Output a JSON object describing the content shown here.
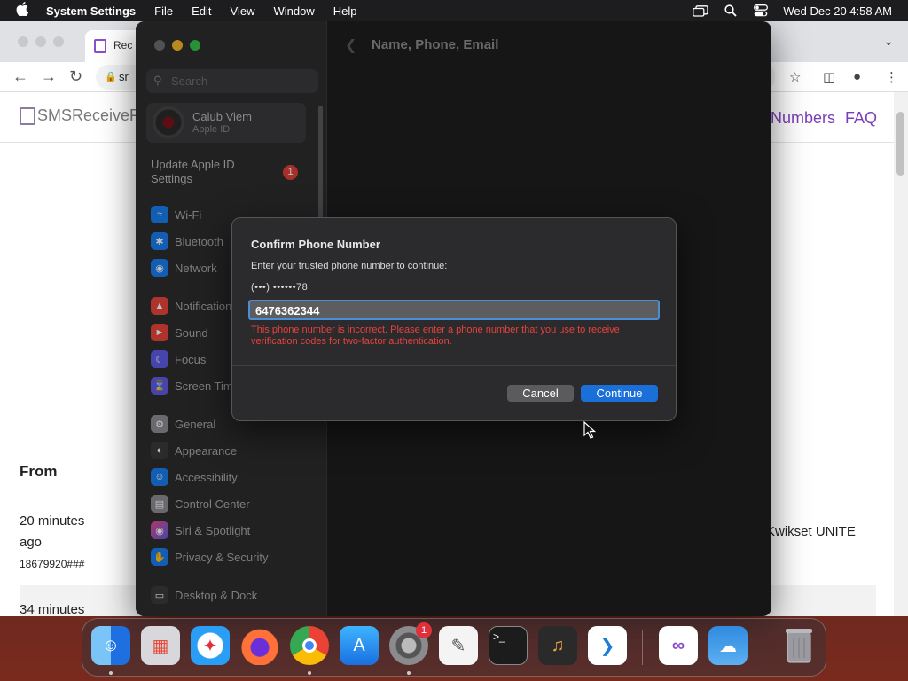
{
  "menubar": {
    "app_name": "System Settings",
    "items": [
      "File",
      "Edit",
      "View",
      "Window",
      "Help"
    ],
    "clock": "Wed Dec 20  4:58 AM"
  },
  "browser": {
    "tab_title": "Rec",
    "url_text": "sr",
    "site_logo": "SMSReceiveFre",
    "nav_numbers": "Numbers",
    "nav_faq": "FAQ",
    "from_heading": "From",
    "time1_line1": "20 minutes",
    "time1_line2": "ago",
    "sender1": "18679920###",
    "message_snippet": "Kwikset UNITE",
    "time2": "34 minutes"
  },
  "settings": {
    "search_placeholder": "Search",
    "account_name": "Calub Viem",
    "account_sub": "Apple ID",
    "update_label": "Update Apple ID Settings",
    "update_badge": "1",
    "content_title": "Name, Phone, Email",
    "sidebar_items": [
      {
        "label": "Wi-Fi",
        "icon": "wifi-icon",
        "color": "#1a7ef2"
      },
      {
        "label": "Bluetooth",
        "icon": "bluetooth-icon",
        "color": "#1a7ef2"
      },
      {
        "label": "Network",
        "icon": "globe-icon",
        "color": "#1a7ef2"
      },
      {
        "label": "Notifications",
        "icon": "bell-icon",
        "color": "#e8443a"
      },
      {
        "label": "Sound",
        "icon": "speaker-icon",
        "color": "#e8443a"
      },
      {
        "label": "Focus",
        "icon": "moon-icon",
        "color": "#5e5ce6"
      },
      {
        "label": "Screen Time",
        "icon": "hourglass-icon",
        "color": "#5e5ce6"
      },
      {
        "label": "General",
        "icon": "gear-icon",
        "color": "#8e8e93"
      },
      {
        "label": "Appearance",
        "icon": "appearance-icon",
        "color": "#3a3a3c"
      },
      {
        "label": "Accessibility",
        "icon": "accessibility-icon",
        "color": "#1a7ef2"
      },
      {
        "label": "Control Center",
        "icon": "control-center-icon",
        "color": "#8e8e93"
      },
      {
        "label": "Siri & Spotlight",
        "icon": "siri-icon",
        "color": "#b04ad8"
      },
      {
        "label": "Privacy & Security",
        "icon": "hand-icon",
        "color": "#1a7ef2"
      },
      {
        "label": "Desktop & Dock",
        "icon": "desktop-icon",
        "color": "#3a3a3c"
      }
    ]
  },
  "dialog": {
    "title": "Confirm Phone Number",
    "prompt": "Enter your trusted phone number to continue:",
    "masked_number": "(•••) ••••••78",
    "input_value": "6476362344",
    "error": "This phone number is incorrect. Please enter a phone number that you use to receive verification codes for two-factor authentication.",
    "cancel_label": "Cancel",
    "continue_label": "Continue"
  },
  "dock": {
    "settings_badge": "1",
    "apps": [
      {
        "name": "Finder",
        "icon": "finder-icon",
        "color": "#1e8cf0"
      },
      {
        "name": "Launchpad",
        "icon": "launchpad-icon",
        "color": "#e6e6e6"
      },
      {
        "name": "Safari",
        "icon": "safari-icon",
        "color": "#2a9df4"
      },
      {
        "name": "Firefox",
        "icon": "firefox-icon",
        "color": "#ff7139"
      },
      {
        "name": "Chrome",
        "icon": "chrome-icon",
        "color": "#ffffff"
      },
      {
        "name": "App Store",
        "icon": "app-store-icon",
        "color": "#1a8cf0"
      },
      {
        "name": "System Settings",
        "icon": "system-settings-icon",
        "color": "#7d7d82"
      },
      {
        "name": "TextEdit",
        "icon": "textedit-icon",
        "color": "#f2f2f2"
      },
      {
        "name": "Terminal",
        "icon": "terminal-icon",
        "color": "#1c1c1c"
      },
      {
        "name": "GarageBand",
        "icon": "garageband-icon",
        "color": "#2a2a2a"
      },
      {
        "name": "VS Code",
        "icon": "vscode-icon",
        "color": "#ffffff"
      },
      {
        "name": "Visual Studio",
        "icon": "visual-studio-icon",
        "color": "#ffffff"
      },
      {
        "name": "Weather",
        "icon": "weather-icon",
        "color": "#2f8ae0"
      },
      {
        "name": "Trash",
        "icon": "trash-icon",
        "color": "#8a8a8f"
      }
    ]
  }
}
